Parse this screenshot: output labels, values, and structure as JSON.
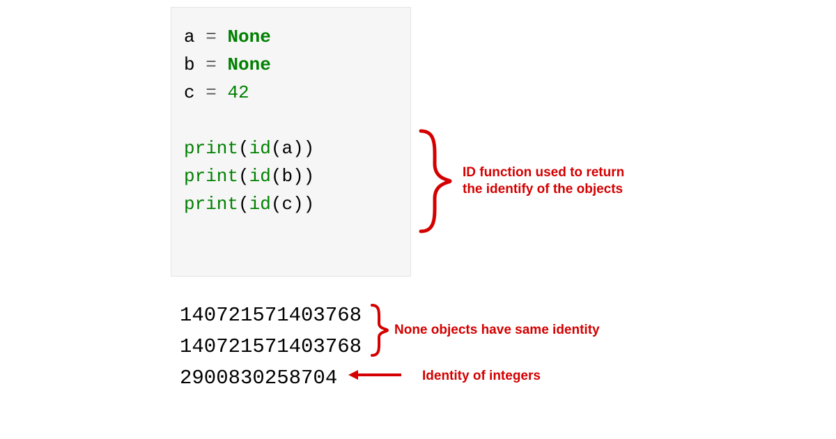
{
  "code": {
    "l1": {
      "var": "a",
      "eq": "=",
      "val": "None"
    },
    "l2": {
      "var": "b",
      "eq": "=",
      "val": "None"
    },
    "l3": {
      "var": "c",
      "eq": "=",
      "val": "42"
    },
    "l5": {
      "fn": "print",
      "id": "id",
      "arg": "a"
    },
    "l6": {
      "fn": "print",
      "id": "id",
      "arg": "b"
    },
    "l7": {
      "fn": "print",
      "id": "id",
      "arg": "c"
    }
  },
  "output": {
    "o1": "140721571403768",
    "o2": "140721571403768",
    "o3": "2900830258704"
  },
  "annotations": {
    "id_fn": "ID function used to return\nthe identify of the objects",
    "none_same": "None objects have same identity",
    "int_identity": "Identity of integers"
  },
  "colors": {
    "annotation": "#d40000",
    "keyword": "#008000"
  }
}
